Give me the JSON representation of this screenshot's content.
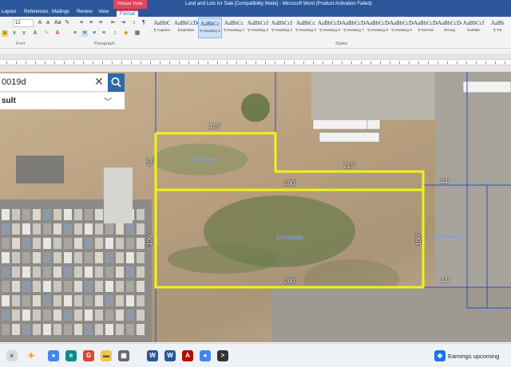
{
  "window": {
    "title": "Land and Lots for Sale [Compatibility Mode] - Microsoft Word (Product Activation Failed)",
    "context_tab": "Picture Tools"
  },
  "ribbon_tabs": [
    "Layout",
    "References",
    "Mailings",
    "Review",
    "View",
    "Format"
  ],
  "ribbon": {
    "font_size": "12",
    "group_font": "Font",
    "group_paragraph": "Paragraph",
    "group_styles": "Styles",
    "styles": [
      {
        "sample": "AaBbC",
        "name": "¶ Caption"
      },
      {
        "sample": "AaBbCcDc",
        "name": "Emphasis"
      },
      {
        "sample": "AaBbCc",
        "name": "¶ Heading 1"
      },
      {
        "sample": "AaBbCc",
        "name": "¶ Heading 2"
      },
      {
        "sample": "AaBbCcI",
        "name": "¶ Heading 3"
      },
      {
        "sample": "AaBbCcI",
        "name": "¶ Heading 4"
      },
      {
        "sample": "AaBbCc",
        "name": "¶ Heading 5"
      },
      {
        "sample": "AaBbCcDc",
        "name": "¶ Heading 6"
      },
      {
        "sample": "AaBbCcDc",
        "name": "¶ Heading 7"
      },
      {
        "sample": "AaBbCcDc",
        "name": "¶ Heading 8"
      },
      {
        "sample": "AaBbCcDc",
        "name": "¶ Heading 9"
      },
      {
        "sample": "AaBbCcDd",
        "name": "¶ Normal"
      },
      {
        "sample": "AaBbCcDc",
        "name": "Strong"
      },
      {
        "sample": "AaBbCcI",
        "name": "Subtitle"
      },
      {
        "sample": "AaBb",
        "name": "¶ Titl"
      }
    ],
    "active_style": 2
  },
  "map": {
    "search_query": "0019d",
    "result_label": "sult",
    "dimensions": {
      "top": "129'",
      "left_upper": "60'",
      "step": "219'",
      "middle": "290'",
      "right_upper": "44'",
      "left_lower": "106'",
      "bottom": "290'",
      "right_lower": "106'",
      "right_bottom": "44'"
    },
    "parcels": {
      "upper": "S1170019D",
      "lower": "S1170019B",
      "right": "S1170019A"
    }
  },
  "taskbar": {
    "news": "Earnings upcoming",
    "icons": [
      "widgets-icon",
      "chrome-icon",
      "edge-icon",
      "google-icon",
      "files-icon",
      "word-icon",
      "word-icon",
      "acrobat-icon",
      "chrome-icon",
      "terminal-icon"
    ]
  }
}
